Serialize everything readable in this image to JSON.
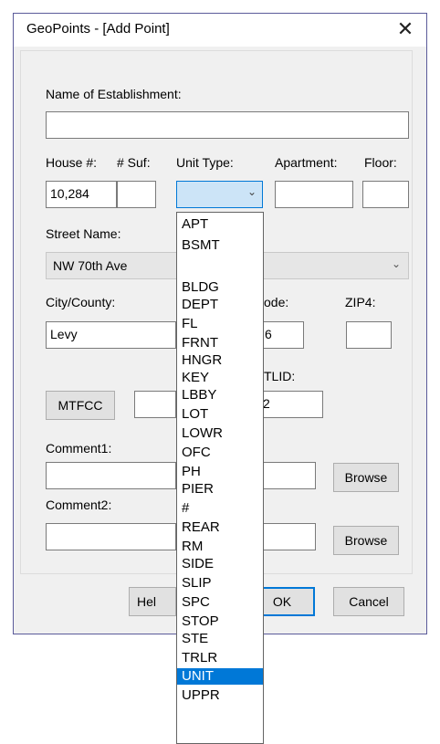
{
  "window": {
    "title": "GeoPoints - [Add Point]",
    "close_glyph": "✕"
  },
  "form": {
    "name_label": "Name of Establishment:",
    "name_value": "",
    "house_label": "House #:",
    "suffix_label": "# Suf:",
    "house_value": "10,284",
    "suffix_value": "",
    "unit_type_label": "Unit Type:",
    "unit_type_value": "",
    "apartment_label": "Apartment:",
    "apartment_value": "",
    "floor_label": "Floor:",
    "floor_value": "",
    "street_label": "Street Name:",
    "street_value": "NW 70th Ave",
    "city_label": "City/County:",
    "city_value": "Levy",
    "zip_label_partial": "ode:",
    "zip_value_partial": "6",
    "zip4_label": "ZIP4:",
    "zip4_value": "",
    "mtfcc_button": "MTFCC",
    "mtfcc_value": "",
    "tlid_label_partial": "TLID:",
    "tlid_value_partial": "2",
    "comment1_label": "Comment1:",
    "comment1_value": "",
    "comment2_label": "Comment2:",
    "comment2_value": "",
    "browse1": "Browse",
    "browse2": "Browse"
  },
  "buttons": {
    "help_partial": "Hel",
    "ok_partial": "OK",
    "cancel": "Cancel"
  },
  "dropdown": {
    "selected": "UNIT",
    "items": [
      "APT",
      "BSMT",
      "",
      "BLDG",
      "DEPT",
      "FL",
      "FRNT",
      "HNGR",
      "KEY",
      "LBBY",
      "LOT",
      "LOWR",
      "OFC",
      "PH",
      "PIER",
      "#",
      "REAR",
      "RM",
      "SIDE",
      "SLIP",
      "SPC",
      "STOP",
      "STE",
      "TRLR",
      "UNIT",
      "UPPR"
    ]
  },
  "icons": {
    "chevron": "chevron-down-icon",
    "close": "close-icon"
  }
}
